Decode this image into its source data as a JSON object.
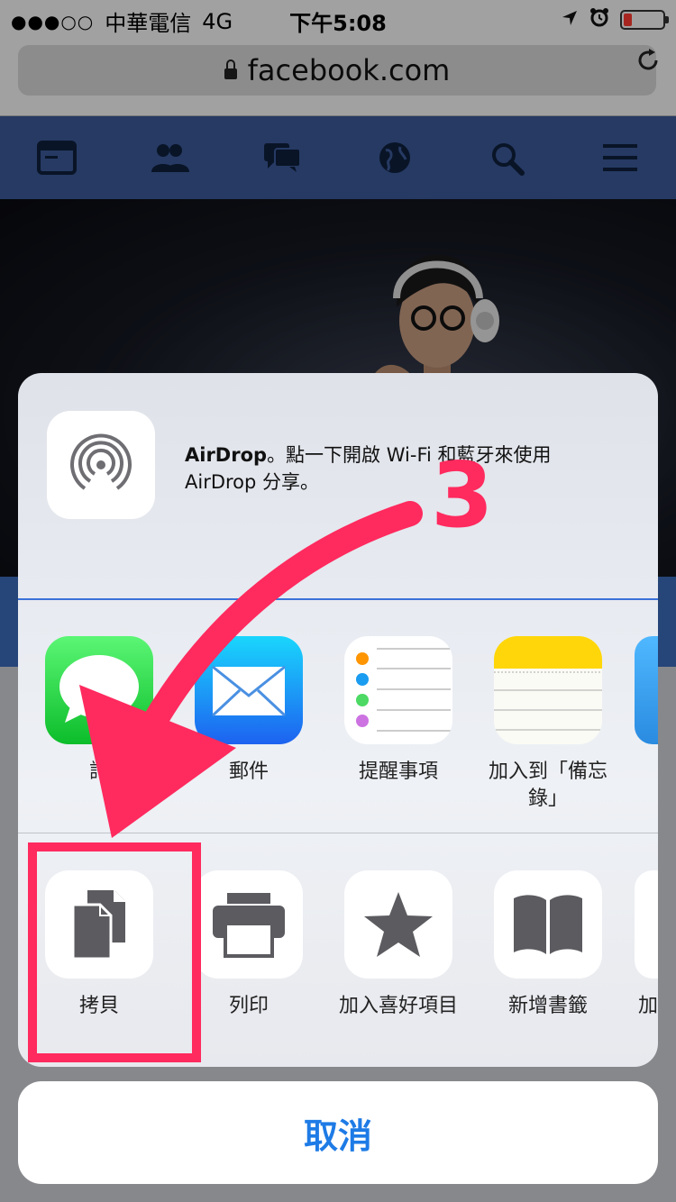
{
  "status": {
    "signal": "●●●○○",
    "carrier": "中華電信",
    "network": "4G",
    "time": "下午5:08",
    "battery_level": 0.2,
    "battery_color": "#ff3b30"
  },
  "browser": {
    "url": "facebook.com"
  },
  "fb_nav": [
    "news-feed-icon",
    "friends-icon",
    "messages-icon",
    "globe-icon",
    "search-icon",
    "menu-icon"
  ],
  "share": {
    "airdrop_title": "AirDrop",
    "airdrop_text": "。點一下開啟 Wi-Fi 和藍牙來使用 AirDrop 分享。",
    "apps": [
      {
        "label": "訊",
        "icon": "messages-icon"
      },
      {
        "label": "郵件",
        "icon": "mail-icon"
      },
      {
        "label": "提醒事項",
        "icon": "reminders-icon"
      },
      {
        "label": "加入到「備忘錄」",
        "icon": "notes-icon"
      }
    ],
    "actions": [
      {
        "label": "拷貝",
        "icon": "copy-icon"
      },
      {
        "label": "列印",
        "icon": "print-icon"
      },
      {
        "label": "加入喜好項目",
        "icon": "star-icon"
      },
      {
        "label": "新增書籤",
        "icon": "book-icon"
      },
      {
        "label": "加",
        "icon": "partial-icon"
      }
    ],
    "cancel": "取消"
  },
  "annotation": {
    "step": "3",
    "color": "#ff2a5e"
  },
  "colors": {
    "fb_blue": "#3b5998",
    "ios_blue": "#1e7be6"
  }
}
